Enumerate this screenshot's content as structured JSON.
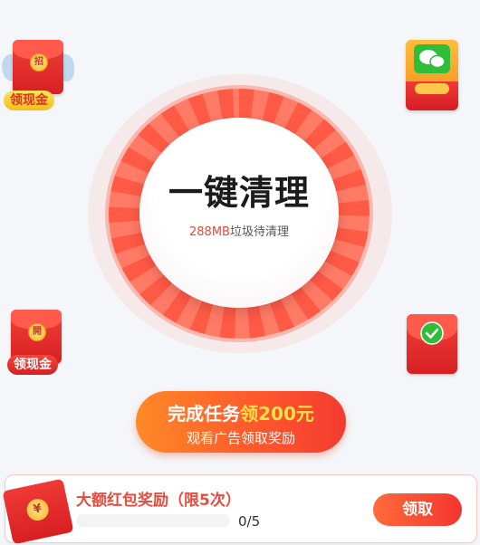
{
  "corner_rewards": {
    "top_left": {
      "label": "领现金",
      "icon": "red-envelope-icon",
      "seal": "招"
    },
    "top_right": {
      "icon": "wechat-red-envelope-icon"
    },
    "mid_left": {
      "label": "领现金",
      "icon": "red-envelope-icon",
      "seal": "開"
    },
    "mid_right": {
      "icon": "wechat-pay-envelope-icon"
    }
  },
  "cleaner": {
    "title": "一键清理",
    "junk_amount": "288MB",
    "junk_suffix": "垃圾待清理"
  },
  "task_button": {
    "line1_prefix": "完成任务",
    "line1_highlight": "领200元",
    "line2": "观看广告领取奖励"
  },
  "bonus_card": {
    "title": "大额红包奖励（限5次）",
    "progress_current": 0,
    "progress_total": 5,
    "progress_text": "0/5",
    "claim_label": "领取",
    "icon": "yuan-coin-envelope-icon"
  },
  "colors": {
    "accent_red": "#f33b31",
    "accent_orange": "#ff8a27",
    "highlight_yellow": "#ffe04a",
    "background": "#f4f6f9"
  }
}
